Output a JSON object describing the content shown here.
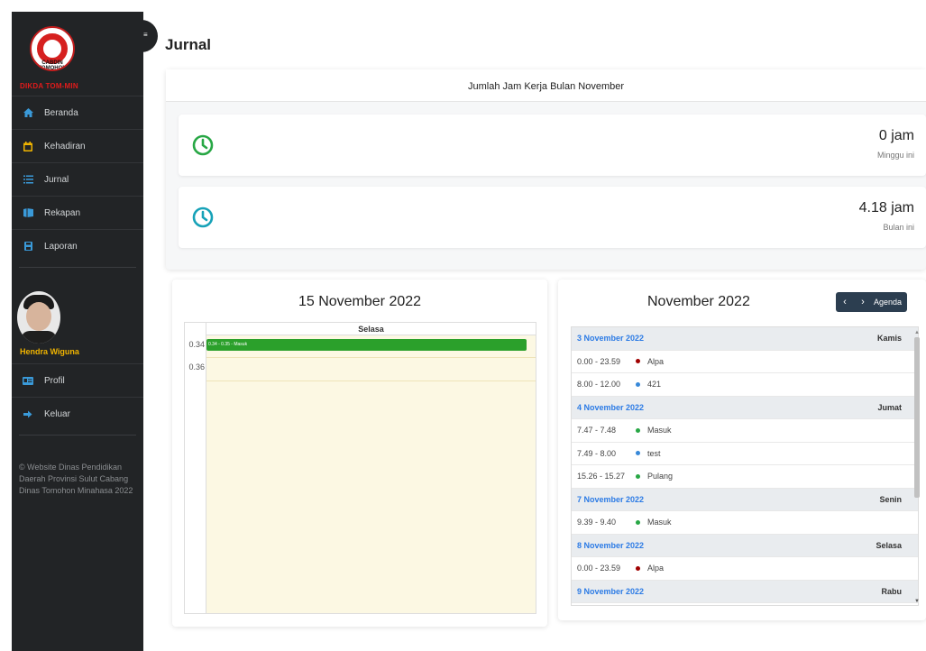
{
  "sidebar": {
    "brand": "DIKDA TOM-MIN",
    "logo_text": "CABDIN TOMOHON",
    "items": [
      {
        "label": "Beranda",
        "icon": "home-icon"
      },
      {
        "label": "Kehadiran",
        "icon": "calendar-icon"
      },
      {
        "label": "Jurnal",
        "icon": "list-icon"
      },
      {
        "label": "Rekapan",
        "icon": "book-icon"
      },
      {
        "label": "Laporan",
        "icon": "save-icon"
      }
    ],
    "user_name": "Hendra Wiguna",
    "user_items": [
      {
        "label": "Profil",
        "icon": "id-card-icon"
      },
      {
        "label": "Keluar",
        "icon": "sign-out-icon"
      }
    ],
    "footer": "© Website Dinas Pendidikan Daerah Provinsi Sulut Cabang Dinas Tomohon Minahasa 2022"
  },
  "page": {
    "title": "Jurnal"
  },
  "summary": {
    "header": "Jumlah Jam Kerja Bulan November",
    "week_value": "0 jam",
    "week_label": "Minggu ini",
    "month_value": "4.18 jam",
    "month_label": "Bulan ini",
    "colors": {
      "week_icon": "#28a745",
      "month_icon": "#17a2b8"
    }
  },
  "day_view": {
    "date": "15 November 2022",
    "column": "Selasa",
    "times": [
      "0.34",
      "0.36"
    ],
    "event": "0.34 - 0.35 - Masuk",
    "event_color": "#2ba02b"
  },
  "list_view": {
    "month": "November 2022",
    "nav": {
      "prev": "‹",
      "next": "›",
      "agenda": "Agenda"
    },
    "rows": [
      {
        "type": "day",
        "date": "3 November 2022",
        "dayname": "Kamis"
      },
      {
        "type": "event",
        "time": "0.00 - 23.59",
        "title": "Alpa",
        "color": "#a00000"
      },
      {
        "type": "event",
        "time": "8.00 - 12.00",
        "title": "421",
        "color": "#3788d8"
      },
      {
        "type": "day",
        "date": "4 November 2022",
        "dayname": "Jumat"
      },
      {
        "type": "event",
        "time": "7.47 - 7.48",
        "title": "Masuk",
        "color": "#28a745"
      },
      {
        "type": "event",
        "time": "7.49 - 8.00",
        "title": "test",
        "color": "#3788d8"
      },
      {
        "type": "event",
        "time": "15.26 - 15.27",
        "title": "Pulang",
        "color": "#28a745"
      },
      {
        "type": "day",
        "date": "7 November 2022",
        "dayname": "Senin"
      },
      {
        "type": "event",
        "time": "9.39 - 9.40",
        "title": "Masuk",
        "color": "#28a745"
      },
      {
        "type": "day",
        "date": "8 November 2022",
        "dayname": "Selasa"
      },
      {
        "type": "event",
        "time": "0.00 - 23.59",
        "title": "Alpa",
        "color": "#a00000"
      },
      {
        "type": "day",
        "date": "9 November 2022",
        "dayname": "Rabu"
      }
    ]
  }
}
